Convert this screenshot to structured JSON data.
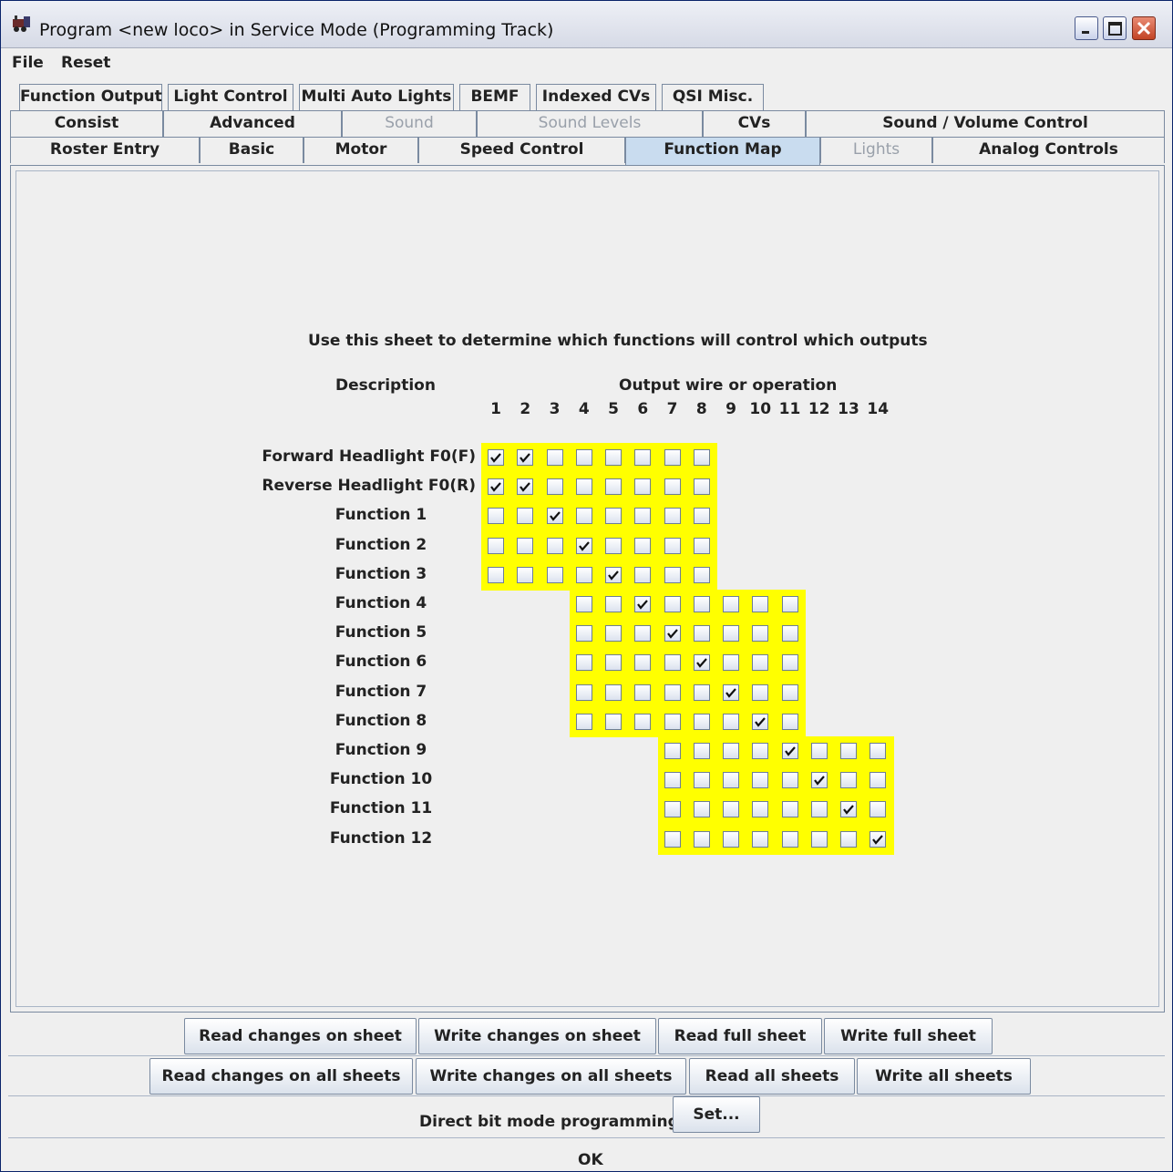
{
  "window": {
    "title": "Program <new loco> in Service Mode (Programming Track)",
    "accent": "#0a246a"
  },
  "menu": {
    "file": "File",
    "reset": "Reset"
  },
  "tabs": {
    "row1": [
      "Function Output",
      "Light Control",
      "Multi Auto Lights",
      "BEMF",
      "Indexed CVs",
      "QSI Misc."
    ],
    "row2": [
      "Consist",
      "Advanced",
      "Sound",
      "Sound Levels",
      "CVs",
      "Sound / Volume Control"
    ],
    "row3": [
      "Roster Entry",
      "Basic",
      "Motor",
      "Speed Control",
      "Function Map",
      "Lights",
      "Analog Controls"
    ],
    "selected": "Function Map",
    "disabled": [
      "Sound",
      "Sound Levels",
      "Lights"
    ]
  },
  "sheet": {
    "instructions": "Use this sheet to determine which functions will control which outputs",
    "description_header": "Description",
    "output_header": "Output wire or operation",
    "columns": [
      "1",
      "2",
      "3",
      "4",
      "5",
      "6",
      "7",
      "8",
      "9",
      "10",
      "11",
      "12",
      "13",
      "14"
    ],
    "highlight_color": "#ffff00",
    "rows": [
      {
        "label": "Forward Headlight F0(F)",
        "start": 1,
        "count": 8,
        "checked": [
          1,
          2
        ]
      },
      {
        "label": "Reverse Headlight F0(R)",
        "start": 1,
        "count": 8,
        "checked": [
          1,
          2
        ]
      },
      {
        "label": "Function 1",
        "start": 1,
        "count": 8,
        "checked": [
          3
        ]
      },
      {
        "label": "Function 2",
        "start": 1,
        "count": 8,
        "checked": [
          4
        ]
      },
      {
        "label": "Function 3",
        "start": 1,
        "count": 8,
        "checked": [
          5
        ]
      },
      {
        "label": "Function 4",
        "start": 4,
        "count": 8,
        "checked": [
          6
        ]
      },
      {
        "label": "Function 5",
        "start": 4,
        "count": 8,
        "checked": [
          7
        ]
      },
      {
        "label": "Function 6",
        "start": 4,
        "count": 8,
        "checked": [
          8
        ]
      },
      {
        "label": "Function 7",
        "start": 4,
        "count": 8,
        "checked": [
          9
        ]
      },
      {
        "label": "Function 8",
        "start": 4,
        "count": 8,
        "checked": [
          10
        ]
      },
      {
        "label": "Function 9",
        "start": 7,
        "count": 8,
        "checked": [
          11
        ]
      },
      {
        "label": "Function 10",
        "start": 7,
        "count": 8,
        "checked": [
          12
        ]
      },
      {
        "label": "Function 11",
        "start": 7,
        "count": 8,
        "checked": [
          13
        ]
      },
      {
        "label": "Function 12",
        "start": 7,
        "count": 8,
        "checked": [
          14
        ]
      }
    ]
  },
  "sheet_buttons": {
    "read_changes": "Read changes on sheet",
    "write_changes": "Write changes on sheet",
    "read_full": "Read full sheet",
    "write_full": "Write full sheet"
  },
  "all_buttons": {
    "read_changes_all": "Read changes on all sheets",
    "write_changes_all": "Write changes on all sheets",
    "read_all": "Read all sheets",
    "write_all": "Write all sheets"
  },
  "direct": {
    "label": "Direct bit mode programming",
    "set": "Set..."
  },
  "status": {
    "text": "OK"
  }
}
